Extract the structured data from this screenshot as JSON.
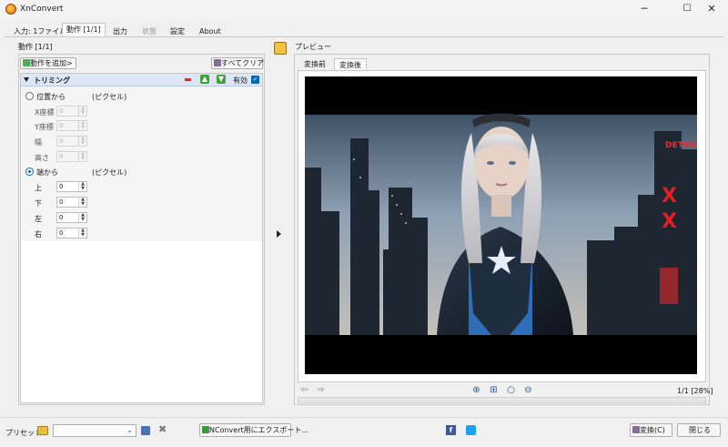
{
  "window": {
    "title": "XnConvert",
    "minimize": "─",
    "maximize": "☐",
    "close": "✕"
  },
  "tabs": [
    {
      "label": "入力: 1ファイル"
    },
    {
      "label": "動作 [1/1]"
    },
    {
      "label": "出力"
    },
    {
      "label": "状態"
    },
    {
      "label": "設定"
    },
    {
      "label": "About"
    }
  ],
  "left": {
    "group_title": "動作 [1/1]",
    "add_action": "動作を追加>",
    "clear_all": "すべてクリア",
    "action": {
      "name": "トリミング",
      "enabled_label": "有効",
      "enabled": true
    },
    "options": {
      "from_position": "位置から",
      "position_unit": "(ピクセル)",
      "x_label": "X座標",
      "y_label": "Y座標",
      "width_label": "幅",
      "height_label": "高さ",
      "x_value": "0",
      "y_value": "0",
      "width_value": "0",
      "height_value": "0",
      "from_edge": "端から",
      "edge_unit": "(ピクセル)",
      "top_label": "上",
      "bottom_label": "下",
      "left_label": "左",
      "right_label": "右",
      "top_value": "0",
      "bottom_value": "0",
      "left_value": "0",
      "right_value": "0"
    }
  },
  "preview": {
    "title": "プレビュー",
    "tab_before": "変換前",
    "tab_after": "変換後",
    "page_info": "1/1 [28%]",
    "sign_text": "DETNAY",
    "sign_x": "X"
  },
  "bottom": {
    "preset_label": "プリセット:",
    "preset_value": "",
    "export_button": "NConvert用にエクスポート...",
    "convert_button": "変換(C)",
    "close_button": "閉じる"
  },
  "colors": {
    "accent": "#0067c0",
    "facebook": "#3b5998",
    "twitter": "#1da1f2",
    "remove": "#d03030",
    "up_down": "#30a030"
  }
}
